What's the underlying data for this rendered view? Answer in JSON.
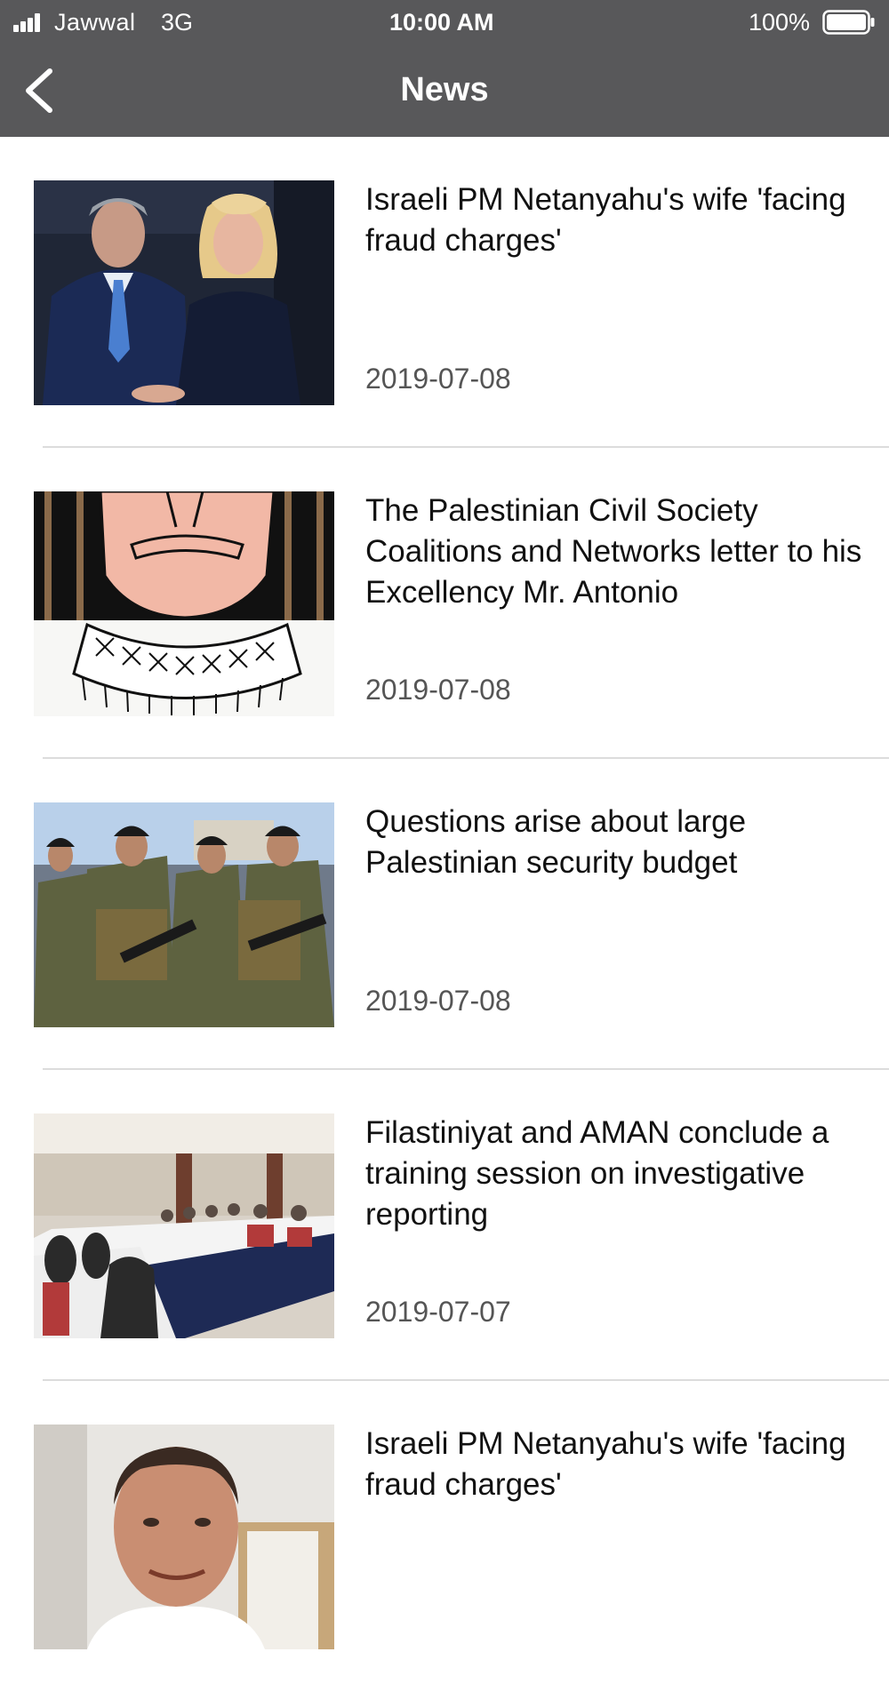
{
  "status_bar": {
    "carrier": "Jawwal",
    "network": "3G",
    "time": "10:00 AM",
    "battery": "100%"
  },
  "nav": {
    "title": "News",
    "back_icon": "chevron-left-icon"
  },
  "news": [
    {
      "title": "Israeli PM Netanyahu's wife 'facing fraud charges'",
      "date": "2019-07-08",
      "image": "couple-photo"
    },
    {
      "title": "The Palestinian Civil Society Coalitions and Networks letter to his Excellency Mr. Antonio",
      "date": "2019-07-08",
      "image": "cartoon-prisoner"
    },
    {
      "title": "Questions arise about large Palestinian security budget",
      "date": "2019-07-08",
      "image": "soldiers-photo"
    },
    {
      "title": "Filastiniyat and AMAN conclude a training session on investigative reporting",
      "date": "2019-07-07",
      "image": "conference-room-photo"
    },
    {
      "title": "Israeli PM Netanyahu's wife 'facing fraud charges'",
      "date": "",
      "image": "man-portrait-photo"
    }
  ],
  "colors": {
    "header_bg": "#58585a",
    "header_text": "#ffffff",
    "title_text": "#111111",
    "date_text": "#555555",
    "divider": "#dcdcdc"
  }
}
